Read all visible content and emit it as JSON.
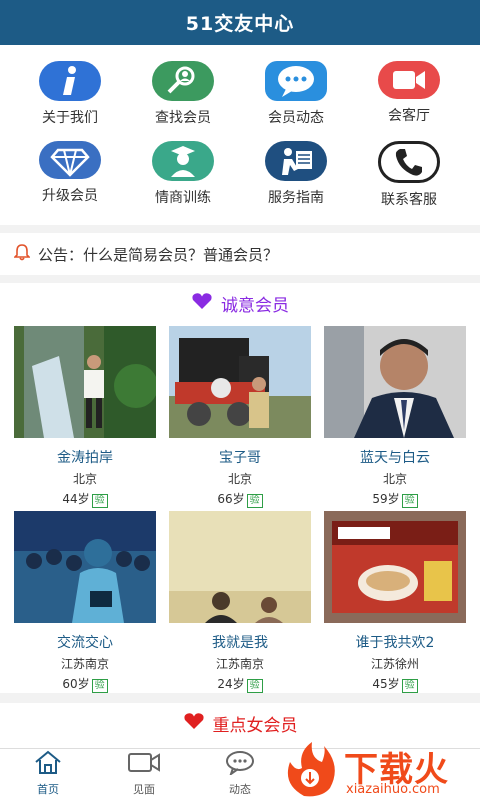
{
  "header": {
    "title": "51交友中心"
  },
  "menu": {
    "items": [
      {
        "label": "关于我们",
        "icon": "info-icon"
      },
      {
        "label": "查找会员",
        "icon": "search-user-icon"
      },
      {
        "label": "会员动态",
        "icon": "chat-bubble-icon"
      },
      {
        "label": "会客厅",
        "icon": "video-camera-icon"
      },
      {
        "label": "升级会员",
        "icon": "diamond-icon"
      },
      {
        "label": "情商训练",
        "icon": "graduate-icon"
      },
      {
        "label": "服务指南",
        "icon": "reader-icon"
      },
      {
        "label": "联系客服",
        "icon": "phone-icon"
      }
    ]
  },
  "notice": {
    "text": "公告：什么是简易会员？普通会员？",
    "icon": "bell-icon"
  },
  "sections": {
    "sincere": {
      "title": "诚意会员",
      "members": [
        {
          "name": "金涛拍岸",
          "city": "北京",
          "age": "44岁"
        },
        {
          "name": "宝子哥",
          "city": "北京",
          "age": "66岁"
        },
        {
          "name": "蓝天与白云",
          "city": "北京",
          "age": "59岁"
        },
        {
          "name": "交流交心",
          "city": "江苏南京",
          "age": "60岁"
        },
        {
          "name": "我就是我",
          "city": "江苏南京",
          "age": "24岁"
        },
        {
          "name": "谁于我共欢2",
          "city": "江苏徐州",
          "age": "45岁"
        }
      ]
    },
    "female": {
      "title": "重点女会员"
    },
    "verified_badge": "验"
  },
  "tabbar": {
    "tabs": [
      {
        "label": "首页",
        "icon": "home-icon",
        "active": true
      },
      {
        "label": "见面",
        "icon": "video-icon",
        "active": false
      },
      {
        "label": "动态",
        "icon": "message-icon",
        "active": false
      }
    ]
  },
  "watermark": {
    "brand": "下载火",
    "url": "xiazaihuo.com"
  },
  "colors": {
    "header_bg": "#1d5b86",
    "accent": "#1d5b86",
    "section1_heart": "#8a2be2",
    "section2_heart": "#e02020"
  }
}
